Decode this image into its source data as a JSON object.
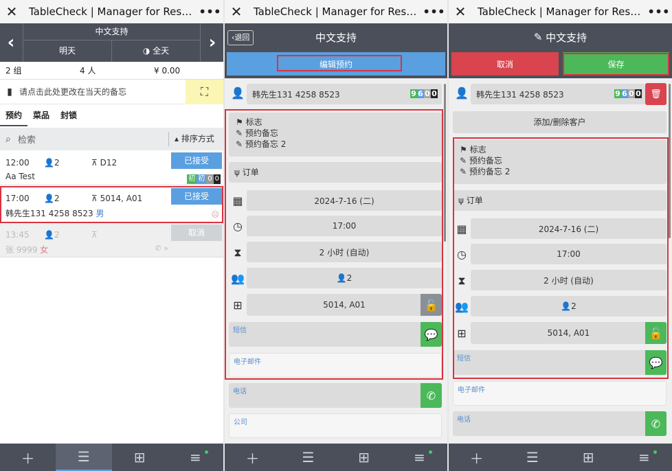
{
  "window_title": "TableCheck | Manager for Restaura...",
  "panel1": {
    "header_title": "中文支持",
    "day_label": "明天",
    "period_label": "全天",
    "stats": {
      "groups": "2 组",
      "people": "4 人",
      "amount": "¥ 0.00"
    },
    "memo_placeholder": "请点击此处更改在当天的备忘",
    "tabs": [
      "预约",
      "菜品",
      "封锁"
    ],
    "search_placeholder": "检索",
    "sort_label": "排序方式",
    "reservations": [
      {
        "time": "12:00",
        "guests": "2",
        "table": "D12",
        "name": "Aa Test",
        "status": "已接受",
        "badges": [
          "初",
          "初",
          "0",
          "0"
        ]
      },
      {
        "time": "17:00",
        "guests": "2",
        "table": "5014, A01",
        "name": "韩先生131 4258 8523",
        "gender": "男",
        "status": "已接受"
      },
      {
        "time": "13:45",
        "guests": "2",
        "table": "",
        "name": "张 9999",
        "gender": "女",
        "status": "取消"
      }
    ]
  },
  "panel2": {
    "back_label": "退回",
    "header_title": "中文支持",
    "edit_button": "编辑预约",
    "customer": "韩先生131 4258 8523",
    "customer_badge": [
      "9",
      "6",
      "0",
      "0"
    ],
    "flags": [
      "标志",
      "预约备忘",
      "预约备忘 2"
    ],
    "order_label": "订单",
    "date": "2024-7-16 (二)",
    "time": "17:00",
    "duration": "2 小时 (自动)",
    "guests": "2",
    "tables": "5014, A01",
    "sms_label": "短信",
    "email_label": "电子邮件",
    "phone_label": "电话",
    "company_label": "公司"
  },
  "panel3": {
    "header_title": "中文支持",
    "cancel_button": "取消",
    "save_button": "保存",
    "customer": "韩先生131 4258 8523",
    "customer_badge": [
      "9",
      "6",
      "0",
      "0"
    ],
    "add_remove_customer": "添加/删除客户",
    "flags": [
      "标志",
      "预约备忘",
      "预约备忘 2"
    ],
    "order_label": "订单",
    "date": "2024-7-16 (二)",
    "time": "17:00",
    "duration": "2 小时 (自动)",
    "guests": "2",
    "tables": "5014, A01",
    "sms_label": "短信",
    "email_label": "电子邮件",
    "phone_label": "电话"
  },
  "colors": {
    "dark": "#4a4f5a",
    "blue": "#5a9fe0",
    "green": "#4cb85a",
    "red": "#d9444f",
    "highlight": "#d9333f"
  }
}
